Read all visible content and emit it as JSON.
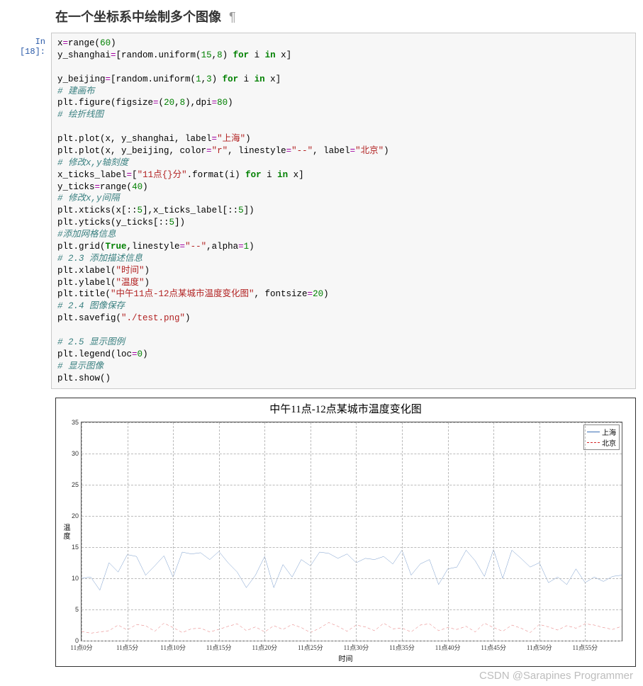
{
  "heading": "在一个坐标系中绘制多个图像",
  "pilcrow": "¶",
  "prompt": "In  [18]:",
  "code_tokens": [
    [
      [
        "fn",
        "x"
      ],
      [
        "op",
        "="
      ],
      [
        "fn",
        "range"
      ],
      [
        "fn",
        "("
      ],
      [
        "num",
        "60"
      ],
      [
        "fn",
        ")"
      ]
    ],
    [
      [
        "fn",
        "y_shanghai"
      ],
      [
        "op",
        "="
      ],
      [
        "fn",
        "[random.uniform("
      ],
      [
        "num",
        "15"
      ],
      [
        "fn",
        ","
      ],
      [
        "num",
        "8"
      ],
      [
        "fn",
        ") "
      ],
      [
        "kw",
        "for"
      ],
      [
        "fn",
        " i "
      ],
      [
        "kw",
        "in"
      ],
      [
        "fn",
        " x]"
      ]
    ],
    [],
    [
      [
        "fn",
        "y_beijing"
      ],
      [
        "op",
        "="
      ],
      [
        "fn",
        "[random.uniform("
      ],
      [
        "num",
        "1"
      ],
      [
        "fn",
        ","
      ],
      [
        "num",
        "3"
      ],
      [
        "fn",
        ") "
      ],
      [
        "kw",
        "for"
      ],
      [
        "fn",
        " i "
      ],
      [
        "kw",
        "in"
      ],
      [
        "fn",
        " x]"
      ]
    ],
    [
      [
        "cmt",
        "# 建画布"
      ]
    ],
    [
      [
        "fn",
        "plt.figure(figsize"
      ],
      [
        "op",
        "="
      ],
      [
        "fn",
        "("
      ],
      [
        "num",
        "20"
      ],
      [
        "fn",
        ","
      ],
      [
        "num",
        "8"
      ],
      [
        "fn",
        "),dpi"
      ],
      [
        "op",
        "="
      ],
      [
        "num",
        "80"
      ],
      [
        "fn",
        ")"
      ]
    ],
    [
      [
        "cmt",
        "# 绘折线图"
      ]
    ],
    [],
    [
      [
        "fn",
        "plt.plot(x, y_shanghai, label"
      ],
      [
        "op",
        "="
      ],
      [
        "str",
        "\"上海\""
      ],
      [
        "fn",
        ")"
      ]
    ],
    [
      [
        "fn",
        "plt.plot(x, y_beijing, color"
      ],
      [
        "op",
        "="
      ],
      [
        "str",
        "\"r\""
      ],
      [
        "fn",
        ", linestyle"
      ],
      [
        "op",
        "="
      ],
      [
        "str",
        "\"--\""
      ],
      [
        "fn",
        ", label"
      ],
      [
        "op",
        "="
      ],
      [
        "str",
        "\"北京\""
      ],
      [
        "fn",
        ")"
      ]
    ],
    [
      [
        "cmt",
        "# 修改x,y轴刻度"
      ]
    ],
    [
      [
        "fn",
        "x_ticks_label"
      ],
      [
        "op",
        "="
      ],
      [
        "fn",
        "["
      ],
      [
        "str",
        "\"11点{}分\""
      ],
      [
        "fn",
        ".format(i) "
      ],
      [
        "kw",
        "for"
      ],
      [
        "fn",
        " i "
      ],
      [
        "kw",
        "in"
      ],
      [
        "fn",
        " x]"
      ]
    ],
    [
      [
        "fn",
        "y_ticks"
      ],
      [
        "op",
        "="
      ],
      [
        "fn",
        "range"
      ],
      [
        "fn",
        "("
      ],
      [
        "num",
        "40"
      ],
      [
        "fn",
        ")"
      ]
    ],
    [
      [
        "cmt",
        "# 修改x,y间隔"
      ]
    ],
    [
      [
        "fn",
        "plt.xticks(x[::"
      ],
      [
        "num",
        "5"
      ],
      [
        "fn",
        "],x_ticks_label[::"
      ],
      [
        "num",
        "5"
      ],
      [
        "fn",
        "])"
      ]
    ],
    [
      [
        "fn",
        "plt.yticks(y_ticks[::"
      ],
      [
        "num",
        "5"
      ],
      [
        "fn",
        "])"
      ]
    ],
    [
      [
        "cmt",
        "#添加网格信息"
      ]
    ],
    [
      [
        "fn",
        "plt.grid("
      ],
      [
        "kw",
        "True"
      ],
      [
        "fn",
        ",linestyle"
      ],
      [
        "op",
        "="
      ],
      [
        "str",
        "\"--\""
      ],
      [
        "fn",
        ",alpha"
      ],
      [
        "op",
        "="
      ],
      [
        "num",
        "1"
      ],
      [
        "fn",
        ")"
      ]
    ],
    [
      [
        "cmt",
        "# 2.3 添加描述信息"
      ]
    ],
    [
      [
        "fn",
        "plt.xlabel("
      ],
      [
        "str",
        "\"时间\""
      ],
      [
        "fn",
        ")"
      ]
    ],
    [
      [
        "fn",
        "plt.ylabel("
      ],
      [
        "str",
        "\"温度\""
      ],
      [
        "fn",
        ")"
      ]
    ],
    [
      [
        "fn",
        "plt.title("
      ],
      [
        "str",
        "\"中午11点-12点某城市温度变化图\""
      ],
      [
        "fn",
        ", fontsize"
      ],
      [
        "op",
        "="
      ],
      [
        "num",
        "20"
      ],
      [
        "fn",
        ")"
      ]
    ],
    [
      [
        "cmt",
        "# 2.4 图像保存"
      ]
    ],
    [
      [
        "fn",
        "plt.savefig("
      ],
      [
        "str",
        "\"./test.png\""
      ],
      [
        "fn",
        ")"
      ]
    ],
    [],
    [
      [
        "cmt",
        "# 2.5 显示图例"
      ]
    ],
    [
      [
        "fn",
        "plt.legend(loc"
      ],
      [
        "op",
        "="
      ],
      [
        "num",
        "0"
      ],
      [
        "fn",
        ")"
      ]
    ],
    [
      [
        "cmt",
        "# 显示图像"
      ]
    ],
    [
      [
        "fn",
        "plt.show()"
      ]
    ]
  ],
  "chart_data": {
    "type": "line",
    "title": "中午11点-12点某城市温度变化图",
    "xlabel": "时间",
    "ylabel": "温度",
    "ylim": [
      0,
      35
    ],
    "yticks": [
      0,
      5,
      10,
      15,
      20,
      25,
      30,
      35
    ],
    "xticks": [
      "11点0分",
      "11点5分",
      "11点10分",
      "11点15分",
      "11点20分",
      "11点25分",
      "11点30分",
      "11点35分",
      "11点40分",
      "11点45分",
      "11点50分",
      "11点55分"
    ],
    "legend": {
      "position": "upper-right"
    },
    "series": [
      {
        "name": "上海",
        "color": "#3b6fb5",
        "dash": false,
        "values": [
          10.0,
          10.2,
          8.1,
          12.5,
          11.0,
          13.8,
          13.5,
          10.5,
          12.0,
          13.6,
          10.2,
          14.2,
          13.9,
          14.1,
          13.0,
          14.3,
          12.5,
          11.0,
          8.5,
          10.5,
          13.5,
          8.5,
          12.2,
          10.2,
          13.0,
          12.0,
          14.2,
          14.0,
          13.2,
          13.9,
          12.5,
          13.2,
          13.0,
          13.5,
          12.3,
          14.5,
          10.5,
          12.3,
          13.0,
          9.0,
          11.5,
          11.8,
          14.5,
          12.8,
          10.3,
          14.6,
          10.0,
          14.5,
          13.2,
          11.8,
          12.5,
          9.3,
          10.2,
          9.0,
          11.5,
          9.3,
          10.2,
          9.5,
          10.3,
          10.5
        ]
      },
      {
        "name": "北京",
        "color": "#d62728",
        "dash": true,
        "values": [
          1.5,
          1.2,
          1.4,
          1.6,
          2.5,
          1.7,
          2.6,
          2.4,
          1.5,
          2.8,
          2.1,
          1.3,
          1.9,
          2.0,
          1.4,
          1.8,
          2.3,
          2.7,
          1.6,
          2.2,
          1.4,
          2.4,
          1.8,
          2.6,
          2.1,
          1.3,
          2.0,
          2.9,
          2.3,
          1.5,
          2.5,
          2.2,
          1.6,
          2.8,
          1.9,
          2.0,
          1.4,
          2.5,
          2.7,
          1.6,
          2.1,
          1.8,
          2.3,
          1.4,
          2.8,
          2.1,
          1.5,
          2.5,
          2.0,
          1.3,
          2.6,
          2.2,
          1.7,
          2.4,
          2.0,
          2.7,
          2.5,
          2.1,
          1.8,
          2.3
        ]
      }
    ]
  },
  "watermark": "CSDN @Sarapines Programmer"
}
